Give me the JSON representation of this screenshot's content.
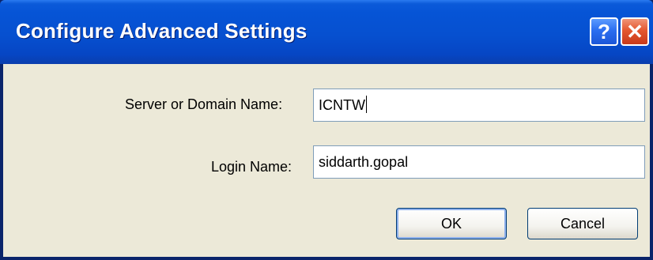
{
  "window": {
    "title": "Configure Advanced Settings",
    "help_label": "?",
    "close_label": "✕"
  },
  "form": {
    "server_label": "Server or Domain Name:",
    "server_value": "ICNTW",
    "login_label": "Login Name:",
    "login_value": "siddarth.gopal"
  },
  "buttons": {
    "ok_label": "OK",
    "cancel_label": "Cancel"
  },
  "colors": {
    "titlebar": "#0654d6",
    "dialog_body": "#ece9d8",
    "close_button": "#e4572f",
    "help_button": "#2b6ef0",
    "field_border": "#7f9db9"
  }
}
